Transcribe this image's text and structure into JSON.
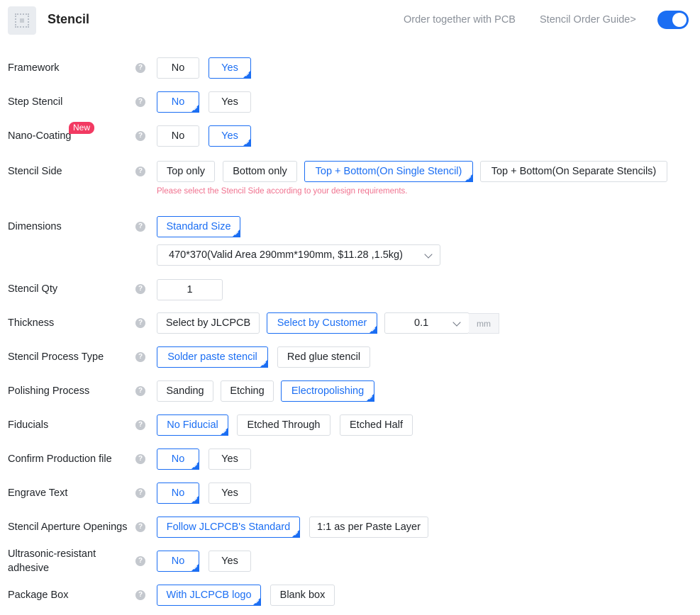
{
  "header": {
    "title": "Stencil",
    "order_with_pcb": "Order together with PCB",
    "guide_link": "Stencil Order Guide>",
    "toggle_on": true
  },
  "colors": {
    "accent": "#1b6ef3",
    "badge": "#f23a62",
    "hint": "#f0728f"
  },
  "icons": {
    "logo": "stencil-icon",
    "help": "question-circle-icon"
  },
  "rows": {
    "framework": {
      "label": "Framework",
      "options": [
        "No",
        "Yes"
      ],
      "selected": "Yes"
    },
    "step_stencil": {
      "label": "Step Stencil",
      "options": [
        "No",
        "Yes"
      ],
      "selected": "No"
    },
    "nano_coating": {
      "label": "Nano-Coating",
      "badge": "New",
      "options": [
        "No",
        "Yes"
      ],
      "selected": "Yes"
    },
    "stencil_side": {
      "label": "Stencil Side",
      "options": [
        "Top only",
        "Bottom only",
        "Top + Bottom(On Single Stencil)",
        "Top + Bottom(On Separate Stencils)"
      ],
      "selected": "Top + Bottom(On Single Stencil)",
      "hint": "Please select the Stencil Side according to your design requirements."
    },
    "dimensions": {
      "label": "Dimensions",
      "options": [
        "Standard Size"
      ],
      "selected": "Standard Size",
      "size_value": "470*370(Valid Area 290mm*190mm, $11.28 ,1.5kg)"
    },
    "stencil_qty": {
      "label": "Stencil Qty",
      "value": "1"
    },
    "thickness": {
      "label": "Thickness",
      "options": [
        "Select by JLCPCB",
        "Select by Customer"
      ],
      "selected": "Select by Customer",
      "value": "0.1",
      "unit": "mm"
    },
    "process_type": {
      "label": "Stencil Process Type",
      "options": [
        "Solder paste stencil",
        "Red glue stencil"
      ],
      "selected": "Solder paste stencil"
    },
    "polishing": {
      "label": "Polishing Process",
      "options": [
        "Sanding",
        "Etching",
        "Electropolishing"
      ],
      "selected": "Electropolishing"
    },
    "fiducials": {
      "label": "Fiducials",
      "options": [
        "No Fiducial",
        "Etched Through",
        "Etched Half"
      ],
      "selected": "No Fiducial"
    },
    "confirm_file": {
      "label": "Confirm Production file",
      "options": [
        "No",
        "Yes"
      ],
      "selected": "No"
    },
    "engrave_text": {
      "label": "Engrave Text",
      "options": [
        "No",
        "Yes"
      ],
      "selected": "No"
    },
    "aperture": {
      "label": "Stencil Aperture Openings",
      "options": [
        "Follow JLCPCB's Standard",
        "1:1 as per Paste Layer"
      ],
      "selected": "Follow JLCPCB's Standard"
    },
    "ultrasonic": {
      "label_line1": "Ultrasonic-resistant",
      "label_line2": "adhesive",
      "options": [
        "No",
        "Yes"
      ],
      "selected": "No"
    },
    "package_box": {
      "label": "Package Box",
      "options": [
        "With JLCPCB logo",
        "Blank box"
      ],
      "selected": "With JLCPCB logo"
    }
  }
}
